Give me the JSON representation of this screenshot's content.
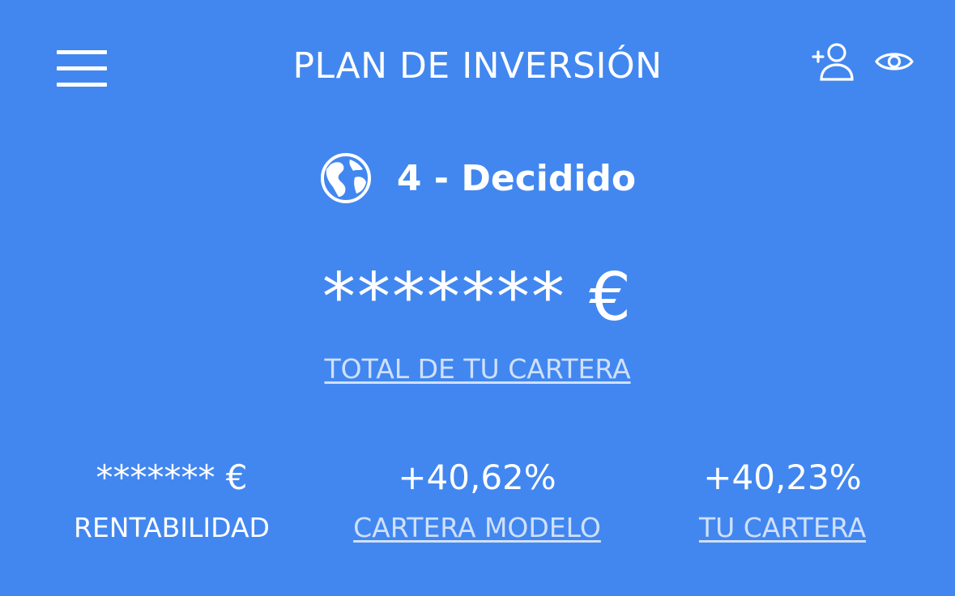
{
  "header": {
    "title": "PLAN DE INVERSIÓN",
    "menu_icon": "hamburger-menu-icon",
    "add_user_icon": "add-user-icon",
    "visibility_icon": "eye-icon"
  },
  "profile": {
    "icon": "globe-icon",
    "label": "4 - Decidido"
  },
  "portfolio": {
    "total_value": "******* €",
    "total_link": "TOTAL DE TU CARTERA"
  },
  "stats": [
    {
      "value": "******* €",
      "label": "RENTABILIDAD"
    },
    {
      "value": "+40,62%",
      "label": "CARTERA MODELO"
    },
    {
      "value": "+40,23%",
      "label": "TU CARTERA"
    }
  ],
  "colors": {
    "background": "#4287f0",
    "text": "#ffffff",
    "link": "#cfe0fb"
  }
}
